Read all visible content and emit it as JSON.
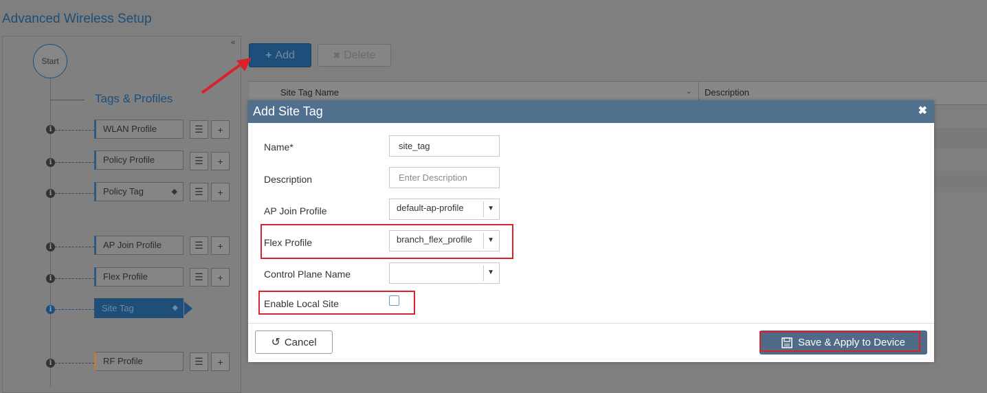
{
  "page": {
    "title": "Advanced Wireless Setup"
  },
  "wizard": {
    "start_label": "Start",
    "section_title": "Tags & Profiles",
    "items": [
      {
        "label": "WLAN Profile"
      },
      {
        "label": "Policy Profile"
      },
      {
        "label": "Policy Tag"
      },
      {
        "label": "AP Join Profile"
      },
      {
        "label": "Flex Profile"
      },
      {
        "label": "Site Tag"
      },
      {
        "label": "RF Profile"
      }
    ],
    "info_glyph": "i",
    "list_glyph": "☰",
    "plus_glyph": "+"
  },
  "toolbar": {
    "add_label": "Add",
    "delete_label": "Delete"
  },
  "table": {
    "columns": [
      "Site Tag Name",
      "Description"
    ]
  },
  "modal": {
    "title": "Add Site Tag",
    "close_glyph": "✖",
    "fields": {
      "name": {
        "label": "Name*",
        "value": "site_tag"
      },
      "description": {
        "label": "Description",
        "placeholder": "Enter Description"
      },
      "ap_join_profile": {
        "label": "AP Join Profile",
        "value": "default-ap-profile"
      },
      "flex_profile": {
        "label": "Flex Profile",
        "value": "branch_flex_profile"
      },
      "control_plane_name": {
        "label": "Control Plane Name",
        "value": ""
      },
      "enable_local_site": {
        "label": "Enable Local Site",
        "checked": false
      }
    },
    "cancel_label": "Cancel",
    "save_label": "Save & Apply to Device"
  },
  "colors": {
    "accent": "#1d4f7a",
    "modal_header": "#50708e",
    "highlight_red": "#d8212a"
  },
  "icons": [
    "collapse-icon",
    "info-icon",
    "list-icon",
    "plus-icon",
    "tag-icon",
    "close-icon",
    "undo-icon",
    "save-disk-icon",
    "caret-down-icon"
  ]
}
